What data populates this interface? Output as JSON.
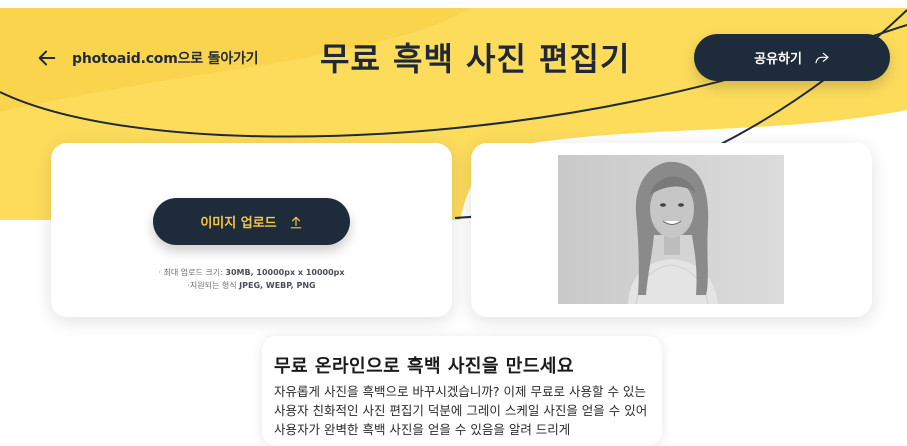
{
  "header": {
    "back_link_label": "photoaid.com으로 돌아가기",
    "title": "무료 흑백 사진 편집기",
    "share_label": "공유하기"
  },
  "upload": {
    "button_label": "이미지 업로드",
    "max_size_prefix": "· 최대 업로드 크기: ",
    "max_size_value": "30MB, 10000px x 10000px",
    "formats_prefix": "·지원되는 형식 ",
    "formats_value": "JPEG, WEBP, PNG"
  },
  "article": {
    "heading": "무료 온라인으로 흑백 사진을 만드세요",
    "body": "자유롭게 사진을 흑백으로 바꾸시겠습니까? 이제 무료로 사용할 수 있는 사용자 친화적인 사진 편집기 덕분에 그레이 스케일 사진을 얻을 수 있어 사용자가 완벽한 흑백 사진을 얻을 수 있음을 알려 드리게"
  },
  "colors": {
    "accent_yellow": "#fddc5c",
    "navy": "#1e2b3b",
    "upload_text": "#f6c648"
  },
  "icons": {
    "back": "arrow-left-icon",
    "share": "share-arrow-icon",
    "upload": "upload-arrow-icon"
  }
}
